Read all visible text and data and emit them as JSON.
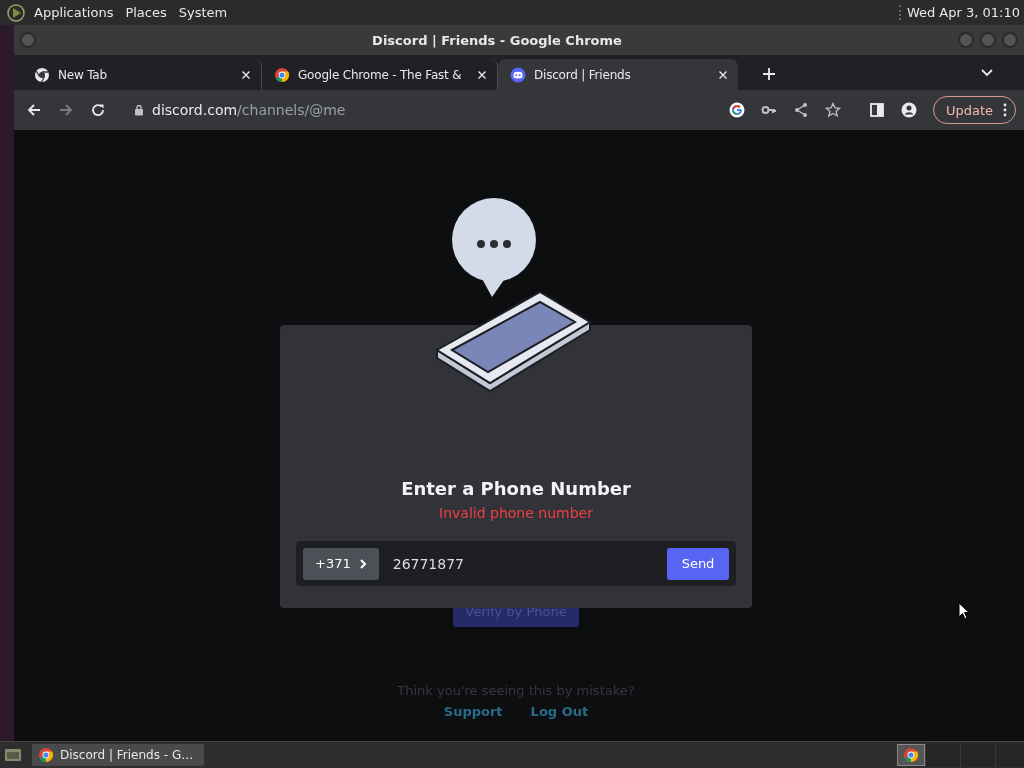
{
  "top_panel": {
    "menus": [
      "Applications",
      "Places",
      "System"
    ],
    "clock": "Wed Apr 3, 01:10"
  },
  "window": {
    "title": "Discord | Friends - Google Chrome"
  },
  "tabs": [
    {
      "label": "New Tab",
      "selected": false
    },
    {
      "label": "Google Chrome - The Fast &",
      "selected": false
    },
    {
      "label": "Discord | Friends",
      "selected": true
    }
  ],
  "address_bar": {
    "domain": "discord.com",
    "path": "/channels/@me",
    "forward_disabled": true
  },
  "update_button": "Update",
  "background_page": {
    "verify_button": "Verify by Phone",
    "prompt": "Think you're seeing this by mistake?",
    "links": [
      "Support",
      "Log Out"
    ]
  },
  "modal": {
    "title": "Enter a Phone Number",
    "error": "Invalid phone number",
    "country_code": "+371",
    "phone": "26771877",
    "send_button": "Send"
  },
  "taskbar": {
    "tasks": [
      {
        "label": "Discord | Friends - G…",
        "selected": false
      }
    ]
  }
}
